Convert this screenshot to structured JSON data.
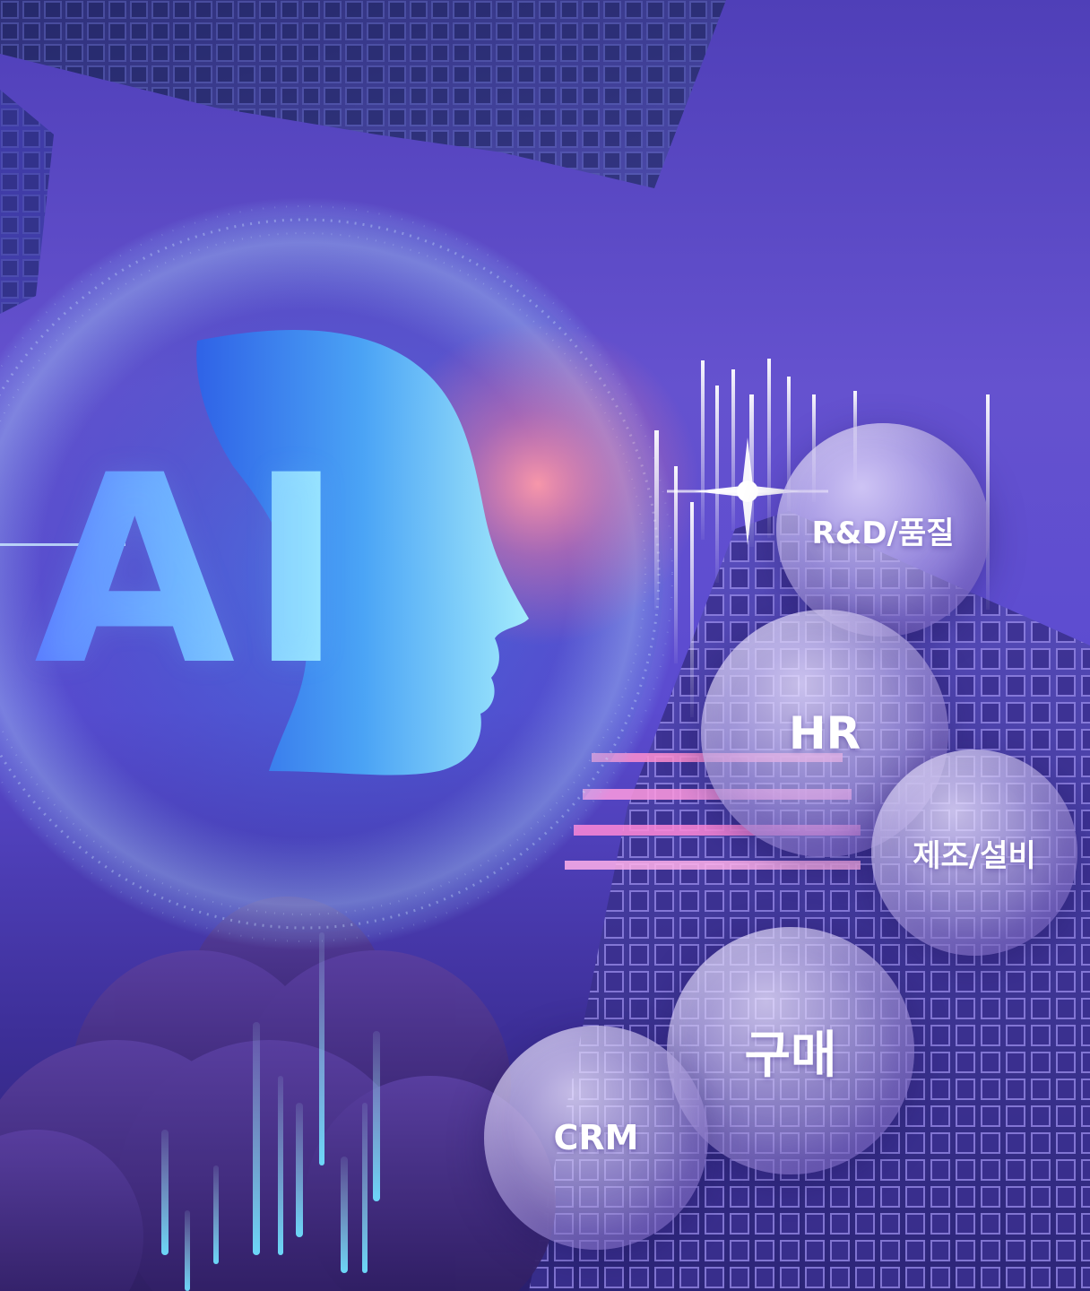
{
  "hero": {
    "headline": "AI",
    "headline_gradient": [
      "#5a7bff",
      "#6fb3ff",
      "#a4f2ff"
    ]
  },
  "domains": [
    {
      "label": "R&D/품질"
    },
    {
      "label": "HR"
    },
    {
      "label": "제조/설비"
    },
    {
      "label": "구매"
    },
    {
      "label": "CRM"
    }
  ],
  "colors": {
    "background_top": "#4f3fb8",
    "background_bottom": "#2a1f6e",
    "glow_accent": "#ff8aa0",
    "bubble_text": "#ffffff"
  }
}
